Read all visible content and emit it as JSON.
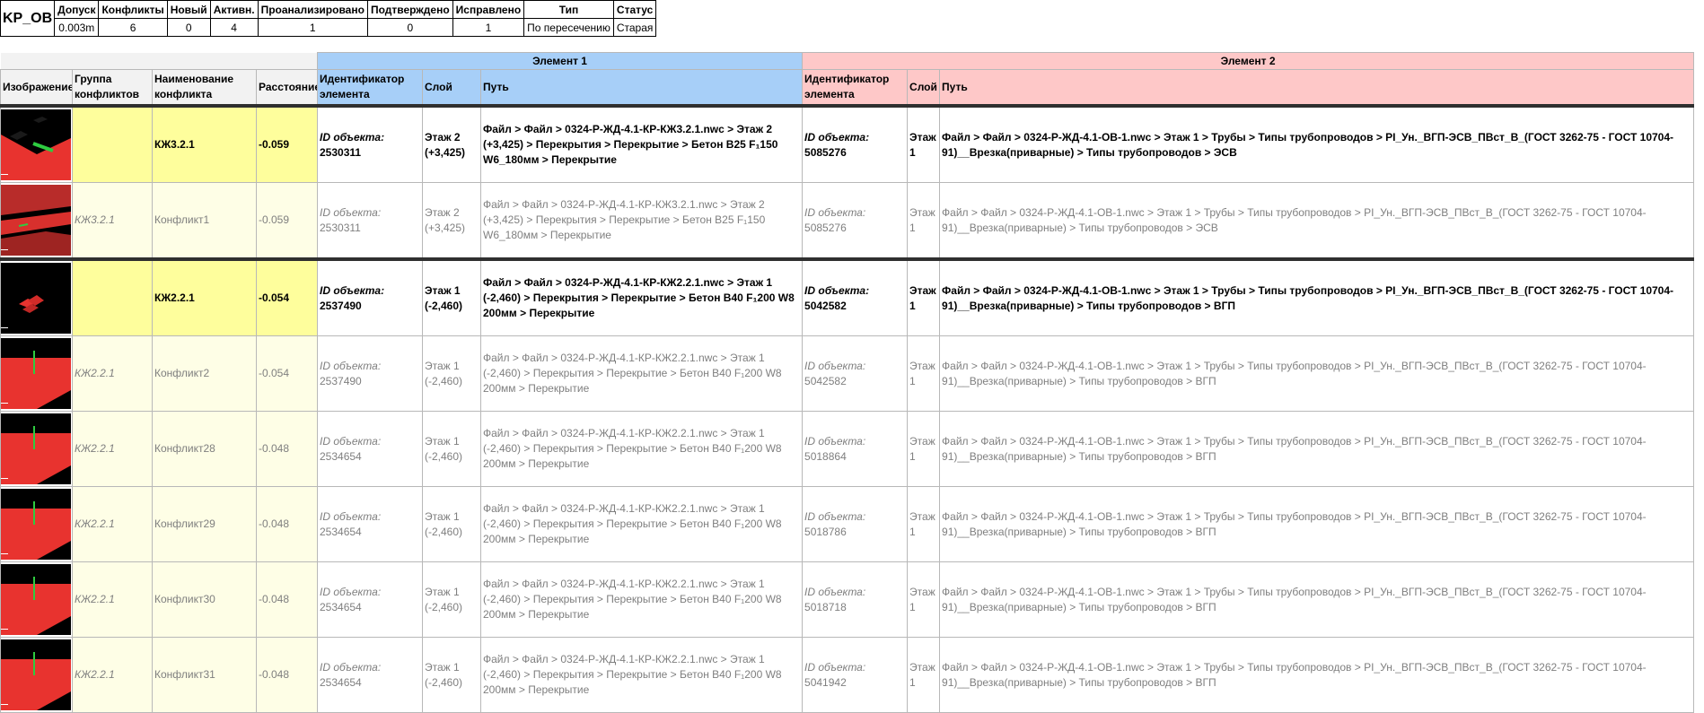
{
  "summary": {
    "test_name": "KP_OB",
    "headers": [
      "Допуск",
      "Конфликты",
      "Новый",
      "Активн.",
      "Проанализировано",
      "Подтверждено",
      "Исправлено",
      "Тип",
      "Статус"
    ],
    "values": [
      "0.003m",
      "6",
      "0",
      "4",
      "1",
      "0",
      "1",
      "По пересечению",
      "Старая"
    ]
  },
  "table": {
    "group_headers": {
      "element1": "Элемент 1",
      "element2": "Элемент 2"
    },
    "columns": {
      "image": "Изображение",
      "group": "Группа конфликтов",
      "name": "Наименование конфликта",
      "distance": "Расстояние",
      "e1_id": "Идентификатор элемента",
      "e1_layer": "Слой",
      "e1_path": "Путь",
      "e2_id": "Идентификатор элемента",
      "e2_layer": "Слой",
      "e2_path": "Путь"
    },
    "id_label": "ID объекта:"
  },
  "rows": [
    {
      "kind": "group",
      "thumb": "red-plane-green-bar",
      "group": "",
      "name": "КЖ3.2.1",
      "distance": "-0.059",
      "e1_id": "2530311",
      "e1_layer": "Этаж 2 (+3,425)",
      "e1_path": "Файл > Файл > 0324-Р-ЖД-4.1-КР-КЖ3.2.1.nwc > Этаж 2 (+3,425) > Перекрытия > Перекрытие > Бетон B25 F₁150 W6_180мм > Перекрытие",
      "e2_id": "5085276",
      "e2_layer": "Этаж 1",
      "e2_path": "Файл > Файл > 0324-Р-ЖД-4.1-ОВ-1.nwc > Этаж 1 > Трубы > Типы трубопроводов > PI_Ун._ВГП-ЭСВ_ПВст_В_(ГОСТ 3262-75 - ГОСТ 10704-91)__Врезка(приварные) > Типы трубопроводов > ЭСВ"
    },
    {
      "kind": "sub",
      "thumb": "red-slab-angle",
      "group": "КЖ3.2.1",
      "name": "Конфликт1",
      "distance": "-0.059",
      "e1_id": "2530311",
      "e1_layer": "Этаж 2 (+3,425)",
      "e1_path": "Файл > Файл > 0324-Р-ЖД-4.1-КР-КЖ3.2.1.nwc > Этаж 2 (+3,425) > Перекрытия > Перекрытие > Бетон B25 F₁150 W6_180мм > Перекрытие",
      "e2_id": "5085276",
      "e2_layer": "Этаж 1",
      "e2_path": "Файл > Файл > 0324-Р-ЖД-4.1-ОВ-1.nwc > Этаж 1 > Трубы > Типы трубопроводов > PI_Ун._ВГП-ЭСВ_ПВст_В_(ГОСТ 3262-75 - ГОСТ 10704-91)__Врезка(приварные) > Типы трубопроводов > ЭСВ"
    },
    {
      "kind": "group",
      "thumb": "black-small-red",
      "group": "",
      "name": "КЖ2.2.1",
      "distance": "-0.054",
      "e1_id": "2537490",
      "e1_layer": "Этаж 1 (-2,460)",
      "e1_path": "Файл > Файл > 0324-Р-ЖД-4.1-КР-КЖ2.2.1.nwc > Этаж 1 (-2,460) > Перекрытия > Перекрытие > Бетон B40 F₁200 W8 200мм > Перекрытие",
      "e2_id": "5042582",
      "e2_layer": "Этаж 1",
      "e2_path": "Файл > Файл > 0324-Р-ЖД-4.1-ОВ-1.nwc > Этаж 1 > Трубы > Типы трубопроводов > PI_Ун._ВГП-ЭСВ_ПВст_В_(ГОСТ 3262-75 - ГОСТ 10704-91)__Врезка(приварные) > Типы трубопроводов > ВГП"
    },
    {
      "kind": "sub",
      "thumb": "red-plane-green-pipe",
      "group": "КЖ2.2.1",
      "name": "Конфликт2",
      "distance": "-0.054",
      "e1_id": "2537490",
      "e1_layer": "Этаж 1 (-2,460)",
      "e1_path": "Файл > Файл > 0324-Р-ЖД-4.1-КР-КЖ2.2.1.nwc > Этаж 1 (-2,460) > Перекрытия > Перекрытие > Бетон B40 F₁200 W8 200мм > Перекрытие",
      "e2_id": "5042582",
      "e2_layer": "Этаж 1",
      "e2_path": "Файл > Файл > 0324-Р-ЖД-4.1-ОВ-1.nwc > Этаж 1 > Трубы > Типы трубопроводов > PI_Ун._ВГП-ЭСВ_ПВст_В_(ГОСТ 3262-75 - ГОСТ 10704-91)__Врезка(приварные) > Типы трубопроводов > ВГП"
    },
    {
      "kind": "sub",
      "thumb": "red-plane-green-pipe",
      "group": "КЖ2.2.1",
      "name": "Конфликт28",
      "distance": "-0.048",
      "e1_id": "2534654",
      "e1_layer": "Этаж 1 (-2,460)",
      "e1_path": "Файл > Файл > 0324-Р-ЖД-4.1-КР-КЖ2.2.1.nwc > Этаж 1 (-2,460) > Перекрытия > Перекрытие > Бетон B40 F₁200 W8 200мм > Перекрытие",
      "e2_id": "5018864",
      "e2_layer": "Этаж 1",
      "e2_path": "Файл > Файл > 0324-Р-ЖД-4.1-ОВ-1.nwc > Этаж 1 > Трубы > Типы трубопроводов > PI_Ун._ВГП-ЭСВ_ПВст_В_(ГОСТ 3262-75 - ГОСТ 10704-91)__Врезка(приварные) > Типы трубопроводов > ВГП"
    },
    {
      "kind": "sub",
      "thumb": "red-plane-green-pipe",
      "group": "КЖ2.2.1",
      "name": "Конфликт29",
      "distance": "-0.048",
      "e1_id": "2534654",
      "e1_layer": "Этаж 1 (-2,460)",
      "e1_path": "Файл > Файл > 0324-Р-ЖД-4.1-КР-КЖ2.2.1.nwc > Этаж 1 (-2,460) > Перекрытия > Перекрытие > Бетон B40 F₁200 W8 200мм > Перекрытие",
      "e2_id": "5018786",
      "e2_layer": "Этаж 1",
      "e2_path": "Файл > Файл > 0324-Р-ЖД-4.1-ОВ-1.nwc > Этаж 1 > Трубы > Типы трубопроводов > PI_Ун._ВГП-ЭСВ_ПВст_В_(ГОСТ 3262-75 - ГОСТ 10704-91)__Врезка(приварные) > Типы трубопроводов > ВГП"
    },
    {
      "kind": "sub",
      "thumb": "red-plane-green-pipe",
      "group": "КЖ2.2.1",
      "name": "Конфликт30",
      "distance": "-0.048",
      "e1_id": "2534654",
      "e1_layer": "Этаж 1 (-2,460)",
      "e1_path": "Файл > Файл > 0324-Р-ЖД-4.1-КР-КЖ2.2.1.nwc > Этаж 1 (-2,460) > Перекрытия > Перекрытие > Бетон B40 F₁200 W8 200мм > Перекрытие",
      "e2_id": "5018718",
      "e2_layer": "Этаж 1",
      "e2_path": "Файл > Файл > 0324-Р-ЖД-4.1-ОВ-1.nwc > Этаж 1 > Трубы > Типы трубопроводов > PI_Ун._ВГП-ЭСВ_ПВст_В_(ГОСТ 3262-75 - ГОСТ 10704-91)__Врезка(приварные) > Типы трубопроводов > ВГП"
    },
    {
      "kind": "sub",
      "thumb": "red-plane-green-pipe",
      "group": "КЖ2.2.1",
      "name": "Конфликт31",
      "distance": "-0.048",
      "e1_id": "2534654",
      "e1_layer": "Этаж 1 (-2,460)",
      "e1_path": "Файл > Файл > 0324-Р-ЖД-4.1-КР-КЖ2.2.1.nwc > Этаж 1 (-2,460) > Перекрытия > Перекрытие > Бетон B40 F₁200 W8 200мм > Перекрытие",
      "e2_id": "5041942",
      "e2_layer": "Этаж 1",
      "e2_path": "Файл > Файл > 0324-Р-ЖД-4.1-ОВ-1.nwc > Этаж 1 > Трубы > Типы трубопроводов > PI_Ун._ВГП-ЭСВ_ПВст_В_(ГОСТ 3262-75 - ГОСТ 10704-91)__Врезка(приварные) > Типы трубопроводов > ВГП"
    }
  ]
}
